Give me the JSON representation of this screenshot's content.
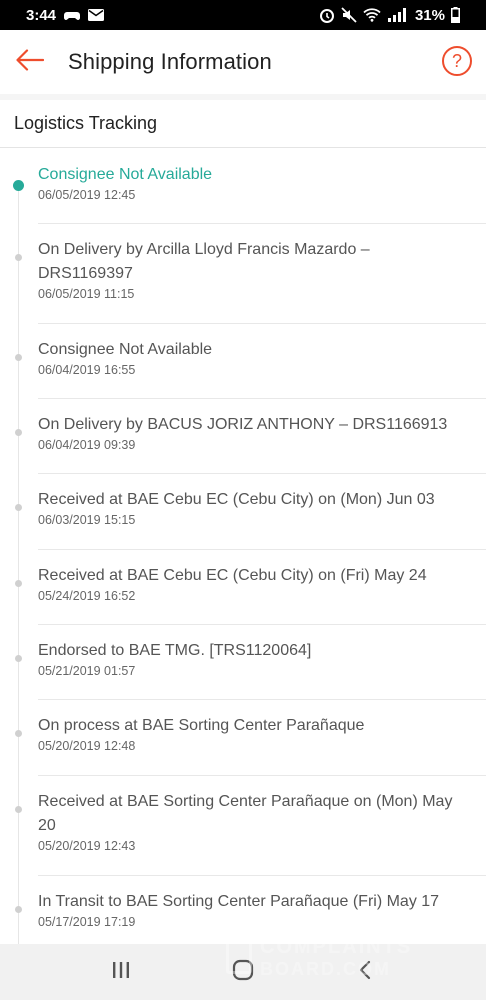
{
  "status_bar": {
    "time": "3:44",
    "battery": "31%",
    "icons": [
      "game-controller-icon",
      "mail-icon",
      "alarm-icon",
      "mute-icon",
      "wifi-icon",
      "signal-icon",
      "battery-icon"
    ]
  },
  "header": {
    "title": "Shipping Information",
    "back_icon": "arrow-left-icon",
    "help_label": "?"
  },
  "section": {
    "title": "Logistics Tracking"
  },
  "events": [
    {
      "description": "Consignee Not Available",
      "time": "06/05/2019 12:45",
      "active": true
    },
    {
      "description": "On Delivery by Arcilla Lloyd Francis Mazardo – DRS1169397",
      "time": "06/05/2019 11:15",
      "active": false
    },
    {
      "description": "Consignee Not Available",
      "time": "06/04/2019 16:55",
      "active": false
    },
    {
      "description": "On Delivery by BACUS JORIZ ANTHONY – DRS1166913",
      "time": "06/04/2019 09:39",
      "active": false
    },
    {
      "description": "Received at BAE Cebu EC (Cebu City) on (Mon) Jun 03",
      "time": "06/03/2019 15:15",
      "active": false
    },
    {
      "description": "Received at BAE Cebu EC (Cebu City) on (Fri) May 24",
      "time": "05/24/2019 16:52",
      "active": false
    },
    {
      "description": "Endorsed to BAE TMG. [TRS1120064]",
      "time": "05/21/2019 01:57",
      "active": false
    },
    {
      "description": "On process at BAE Sorting Center Parañaque",
      "time": "05/20/2019 12:48",
      "active": false
    },
    {
      "description": "Received at BAE Sorting Center Parañaque on (Mon) May 20",
      "time": "05/20/2019 12:43",
      "active": false
    },
    {
      "description": "In Transit to BAE Sorting Center Parañaque (Fri) May 17",
      "time": "05/17/2019 17:19",
      "active": false
    }
  ],
  "watermark": {
    "line1": "COMPLAINTS",
    "line2": "BOARD.COM"
  },
  "nav_bar": {
    "icons": [
      "recent-apps-icon",
      "home-icon",
      "back-icon"
    ]
  },
  "colors": {
    "accent": "#ee4d2d",
    "active_status": "#26aa99",
    "inactive_dot": "#d0d0d0"
  }
}
